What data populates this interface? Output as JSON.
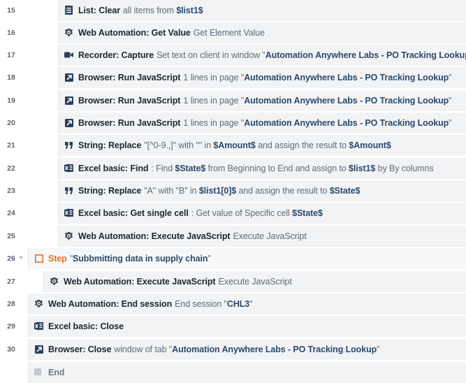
{
  "rows": [
    {
      "num": "15",
      "action": "List: Clear",
      "parts": [
        {
          "t": "all items from ",
          "k": "plain"
        },
        {
          "t": "$list1$",
          "k": "var"
        }
      ]
    },
    {
      "num": "16",
      "action": "Web Automation: Get Value",
      "parts": [
        {
          "t": "Get Element Value",
          "k": "plain"
        }
      ]
    },
    {
      "num": "17",
      "action": "Recorder: Capture",
      "parts": [
        {
          "t": "Set text on client in window \"",
          "k": "plain"
        },
        {
          "t": "Automation Anywhere Labs - PO Tracking Lookup",
          "k": "var"
        },
        {
          "t": "\"",
          "k": "plain"
        }
      ]
    },
    {
      "num": "18",
      "action": "Browser: Run JavaScript",
      "parts": [
        {
          "t": "1 lines in page \"",
          "k": "plain"
        },
        {
          "t": "Automation Anywhere Labs - PO Tracking Lookup",
          "k": "var"
        },
        {
          "t": "\"",
          "k": "plain"
        }
      ]
    },
    {
      "num": "19",
      "action": "Browser: Run JavaScript",
      "parts": [
        {
          "t": "1 lines in page \"",
          "k": "plain"
        },
        {
          "t": "Automation Anywhere Labs - PO Tracking Lookup",
          "k": "var"
        },
        {
          "t": "\"",
          "k": "plain"
        }
      ]
    },
    {
      "num": "20",
      "action": "Browser: Run JavaScript",
      "parts": [
        {
          "t": "1 lines in page \"",
          "k": "plain"
        },
        {
          "t": "Automation Anywhere Labs - PO Tracking Lookup",
          "k": "var"
        },
        {
          "t": "\"",
          "k": "plain"
        }
      ]
    },
    {
      "num": "21",
      "action": "String: Replace",
      "parts": [
        {
          "t": "\"[^0-9.,]\" with \"\" in ",
          "k": "plain"
        },
        {
          "t": "$Amount$",
          "k": "var"
        },
        {
          "t": " and assign the result to ",
          "k": "plain"
        },
        {
          "t": "$Amount$",
          "k": "var"
        }
      ]
    },
    {
      "num": "22",
      "action": "Excel basic: Find",
      "parts": [
        {
          "t": ": Find ",
          "k": "plain"
        },
        {
          "t": "$State$",
          "k": "var"
        },
        {
          "t": " from Beginning to End and assign to ",
          "k": "plain"
        },
        {
          "t": "$list1$",
          "k": "var"
        },
        {
          "t": " by By columns",
          "k": "plain"
        }
      ]
    },
    {
      "num": "23",
      "action": "String: Replace",
      "parts": [
        {
          "t": "\"A\" with \"B\" in ",
          "k": "plain"
        },
        {
          "t": "$list1[0]$",
          "k": "var"
        },
        {
          "t": " and assign the result to ",
          "k": "plain"
        },
        {
          "t": "$State$",
          "k": "var"
        }
      ]
    },
    {
      "num": "24",
      "action": "Excel basic: Get single cell",
      "parts": [
        {
          "t": ": Get value of Specific cell ",
          "k": "plain"
        },
        {
          "t": "$State$",
          "k": "var"
        }
      ]
    },
    {
      "num": "25",
      "action": "Web Automation: Execute JavaScript",
      "parts": [
        {
          "t": "Execute JavaScript",
          "k": "plain"
        }
      ]
    },
    {
      "num": "26",
      "action": "Step",
      "parts": [
        {
          "t": "\"",
          "k": "plain"
        },
        {
          "t": "Subbmitting data in supply chain",
          "k": "var"
        },
        {
          "t": "\"",
          "k": "plain"
        }
      ]
    },
    {
      "num": "27",
      "action": "Web Automation: Execute JavaScript",
      "parts": [
        {
          "t": "Execute JavaScript",
          "k": "plain"
        }
      ]
    },
    {
      "num": "28",
      "action": "Web Automation: End session",
      "parts": [
        {
          "t": "End session \"",
          "k": "plain"
        },
        {
          "t": "CHL3",
          "k": "var"
        },
        {
          "t": "\"",
          "k": "plain"
        }
      ]
    },
    {
      "num": "29",
      "action": "Excel basic: Close",
      "parts": []
    },
    {
      "num": "30",
      "action": "Browser: Close",
      "parts": [
        {
          "t": "window of tab \"",
          "k": "plain"
        },
        {
          "t": "Automation Anywhere Labs - PO Tracking Lookup",
          "k": "var"
        },
        {
          "t": "\"",
          "k": "plain"
        }
      ]
    },
    {
      "num": "",
      "action": "End",
      "parts": []
    }
  ],
  "icons": {
    "list": "list-icon",
    "web": "web-automation-icon",
    "recorder": "video-camera-icon",
    "browser": "browser-arrow-icon",
    "string": "quote-icon",
    "excel": "excel-icon",
    "step": "step-square-icon",
    "end": "end-square-icon",
    "collapse": "caret-down-icon"
  },
  "colors": {
    "action_text": "#202830",
    "variable_text": "#2c4a6b",
    "plain_text": "#5f6b77",
    "step_accent": "#e8712a",
    "row_background": "#f1f3f5",
    "icon_navy": "#2b3f5a"
  }
}
